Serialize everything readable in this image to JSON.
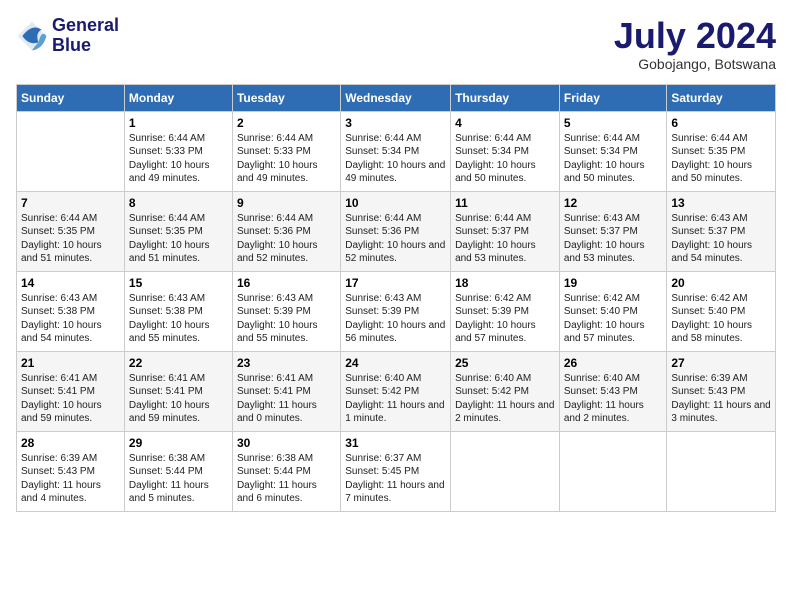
{
  "header": {
    "logo_line1": "General",
    "logo_line2": "Blue",
    "month": "July 2024",
    "location": "Gobojango, Botswana"
  },
  "days_of_week": [
    "Sunday",
    "Monday",
    "Tuesday",
    "Wednesday",
    "Thursday",
    "Friday",
    "Saturday"
  ],
  "weeks": [
    [
      {
        "day": "",
        "sunrise": "",
        "sunset": "",
        "daylight": ""
      },
      {
        "day": "1",
        "sunrise": "Sunrise: 6:44 AM",
        "sunset": "Sunset: 5:33 PM",
        "daylight": "Daylight: 10 hours and 49 minutes."
      },
      {
        "day": "2",
        "sunrise": "Sunrise: 6:44 AM",
        "sunset": "Sunset: 5:33 PM",
        "daylight": "Daylight: 10 hours and 49 minutes."
      },
      {
        "day": "3",
        "sunrise": "Sunrise: 6:44 AM",
        "sunset": "Sunset: 5:34 PM",
        "daylight": "Daylight: 10 hours and 49 minutes."
      },
      {
        "day": "4",
        "sunrise": "Sunrise: 6:44 AM",
        "sunset": "Sunset: 5:34 PM",
        "daylight": "Daylight: 10 hours and 50 minutes."
      },
      {
        "day": "5",
        "sunrise": "Sunrise: 6:44 AM",
        "sunset": "Sunset: 5:34 PM",
        "daylight": "Daylight: 10 hours and 50 minutes."
      },
      {
        "day": "6",
        "sunrise": "Sunrise: 6:44 AM",
        "sunset": "Sunset: 5:35 PM",
        "daylight": "Daylight: 10 hours and 50 minutes."
      }
    ],
    [
      {
        "day": "7",
        "sunrise": "Sunrise: 6:44 AM",
        "sunset": "Sunset: 5:35 PM",
        "daylight": "Daylight: 10 hours and 51 minutes."
      },
      {
        "day": "8",
        "sunrise": "Sunrise: 6:44 AM",
        "sunset": "Sunset: 5:35 PM",
        "daylight": "Daylight: 10 hours and 51 minutes."
      },
      {
        "day": "9",
        "sunrise": "Sunrise: 6:44 AM",
        "sunset": "Sunset: 5:36 PM",
        "daylight": "Daylight: 10 hours and 52 minutes."
      },
      {
        "day": "10",
        "sunrise": "Sunrise: 6:44 AM",
        "sunset": "Sunset: 5:36 PM",
        "daylight": "Daylight: 10 hours and 52 minutes."
      },
      {
        "day": "11",
        "sunrise": "Sunrise: 6:44 AM",
        "sunset": "Sunset: 5:37 PM",
        "daylight": "Daylight: 10 hours and 53 minutes."
      },
      {
        "day": "12",
        "sunrise": "Sunrise: 6:43 AM",
        "sunset": "Sunset: 5:37 PM",
        "daylight": "Daylight: 10 hours and 53 minutes."
      },
      {
        "day": "13",
        "sunrise": "Sunrise: 6:43 AM",
        "sunset": "Sunset: 5:37 PM",
        "daylight": "Daylight: 10 hours and 54 minutes."
      }
    ],
    [
      {
        "day": "14",
        "sunrise": "Sunrise: 6:43 AM",
        "sunset": "Sunset: 5:38 PM",
        "daylight": "Daylight: 10 hours and 54 minutes."
      },
      {
        "day": "15",
        "sunrise": "Sunrise: 6:43 AM",
        "sunset": "Sunset: 5:38 PM",
        "daylight": "Daylight: 10 hours and 55 minutes."
      },
      {
        "day": "16",
        "sunrise": "Sunrise: 6:43 AM",
        "sunset": "Sunset: 5:39 PM",
        "daylight": "Daylight: 10 hours and 55 minutes."
      },
      {
        "day": "17",
        "sunrise": "Sunrise: 6:43 AM",
        "sunset": "Sunset: 5:39 PM",
        "daylight": "Daylight: 10 hours and 56 minutes."
      },
      {
        "day": "18",
        "sunrise": "Sunrise: 6:42 AM",
        "sunset": "Sunset: 5:39 PM",
        "daylight": "Daylight: 10 hours and 57 minutes."
      },
      {
        "day": "19",
        "sunrise": "Sunrise: 6:42 AM",
        "sunset": "Sunset: 5:40 PM",
        "daylight": "Daylight: 10 hours and 57 minutes."
      },
      {
        "day": "20",
        "sunrise": "Sunrise: 6:42 AM",
        "sunset": "Sunset: 5:40 PM",
        "daylight": "Daylight: 10 hours and 58 minutes."
      }
    ],
    [
      {
        "day": "21",
        "sunrise": "Sunrise: 6:41 AM",
        "sunset": "Sunset: 5:41 PM",
        "daylight": "Daylight: 10 hours and 59 minutes."
      },
      {
        "day": "22",
        "sunrise": "Sunrise: 6:41 AM",
        "sunset": "Sunset: 5:41 PM",
        "daylight": "Daylight: 10 hours and 59 minutes."
      },
      {
        "day": "23",
        "sunrise": "Sunrise: 6:41 AM",
        "sunset": "Sunset: 5:41 PM",
        "daylight": "Daylight: 11 hours and 0 minutes."
      },
      {
        "day": "24",
        "sunrise": "Sunrise: 6:40 AM",
        "sunset": "Sunset: 5:42 PM",
        "daylight": "Daylight: 11 hours and 1 minute."
      },
      {
        "day": "25",
        "sunrise": "Sunrise: 6:40 AM",
        "sunset": "Sunset: 5:42 PM",
        "daylight": "Daylight: 11 hours and 2 minutes."
      },
      {
        "day": "26",
        "sunrise": "Sunrise: 6:40 AM",
        "sunset": "Sunset: 5:43 PM",
        "daylight": "Daylight: 11 hours and 2 minutes."
      },
      {
        "day": "27",
        "sunrise": "Sunrise: 6:39 AM",
        "sunset": "Sunset: 5:43 PM",
        "daylight": "Daylight: 11 hours and 3 minutes."
      }
    ],
    [
      {
        "day": "28",
        "sunrise": "Sunrise: 6:39 AM",
        "sunset": "Sunset: 5:43 PM",
        "daylight": "Daylight: 11 hours and 4 minutes."
      },
      {
        "day": "29",
        "sunrise": "Sunrise: 6:38 AM",
        "sunset": "Sunset: 5:44 PM",
        "daylight": "Daylight: 11 hours and 5 minutes."
      },
      {
        "day": "30",
        "sunrise": "Sunrise: 6:38 AM",
        "sunset": "Sunset: 5:44 PM",
        "daylight": "Daylight: 11 hours and 6 minutes."
      },
      {
        "day": "31",
        "sunrise": "Sunrise: 6:37 AM",
        "sunset": "Sunset: 5:45 PM",
        "daylight": "Daylight: 11 hours and 7 minutes."
      },
      {
        "day": "",
        "sunrise": "",
        "sunset": "",
        "daylight": ""
      },
      {
        "day": "",
        "sunrise": "",
        "sunset": "",
        "daylight": ""
      },
      {
        "day": "",
        "sunrise": "",
        "sunset": "",
        "daylight": ""
      }
    ]
  ]
}
